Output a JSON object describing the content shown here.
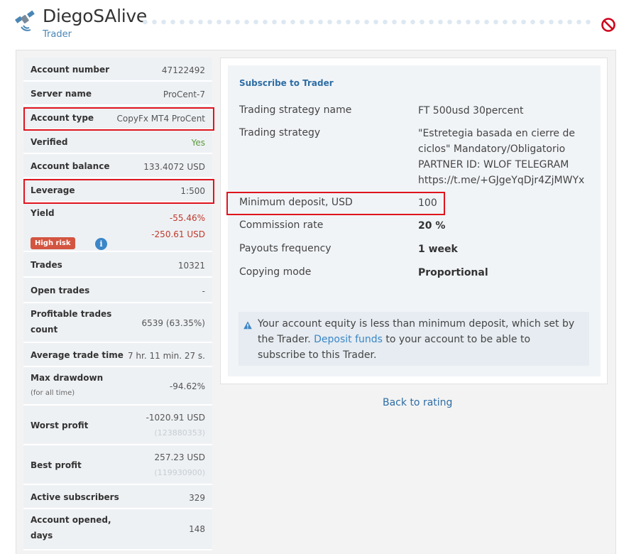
{
  "header": {
    "title": "DiegoSAlive",
    "subtitle": "Trader",
    "logo_icon": "satellite-icon",
    "status_icon": "blocked-icon"
  },
  "stats": {
    "account_number": {
      "label": "Account number",
      "value": "47122492"
    },
    "server_name": {
      "label": "Server name",
      "value": "ProCent-7"
    },
    "account_type": {
      "label": "Account type",
      "value": "CopyFx MT4 ProCent"
    },
    "verified": {
      "label": "Verified",
      "value": "Yes"
    },
    "account_balance": {
      "label": "Account balance",
      "value": "133.4072 USD"
    },
    "leverage": {
      "label": "Leverage",
      "value": "1:500"
    },
    "yield": {
      "label": "Yield",
      "value_pct": "-55.46%",
      "value_usd": "-250.61 USD",
      "badge": "High risk"
    },
    "trades": {
      "label": "Trades",
      "value": "10321"
    },
    "open_trades": {
      "label": "Open trades",
      "value": "-"
    },
    "profitable_trades": {
      "label_line1": "Profitable trades",
      "label_line2": "count",
      "value": "6539 (63.35%)"
    },
    "average_trade_time": {
      "label": "Average trade time",
      "value": "7 hr. 11 min. 27 s."
    },
    "max_drawdown": {
      "label": "Max drawdown",
      "sublabel": "(for all time)",
      "value": "-94.62%"
    },
    "worst_profit": {
      "label": "Worst profit",
      "value": "-1020.91 USD",
      "ticket": "(123880353)"
    },
    "best_profit": {
      "label": "Best profit",
      "value": "257.23 USD",
      "ticket": "(119930900)"
    },
    "active_subscribers": {
      "label": "Active subscribers",
      "value": "329"
    },
    "account_opened": {
      "label_line1": "Account opened,",
      "label_line2": "days",
      "value": "148"
    }
  },
  "subscribe": {
    "heading": "Subscribe to Trader",
    "strategy_name_label": "Trading strategy name",
    "strategy_name_value": "FT 500usd 30percent",
    "strategy_label": "Trading strategy",
    "strategy_line1": "\"Estretegia basada en cierre de",
    "strategy_line2": "ciclos\" Mandatory/Obligatorio",
    "strategy_line3": "PARTNER ID: WLOF TELEGRAM",
    "strategy_line4": "https://t.me/+GJgeYqDjr4ZjMWYx",
    "min_deposit_label": "Minimum deposit, USD",
    "min_deposit_value": "100",
    "commission_label": "Commission rate",
    "commission_value": "20 %",
    "payouts_label": "Payouts frequency",
    "payouts_value": "1 week",
    "copying_label": "Copying mode",
    "copying_value": "Proportional",
    "notice_before": "Your account equity is less than minimum deposit, which set by the Trader. ",
    "notice_link": "Deposit funds",
    "notice_after": " to your account to be able to subscribe to this Trader."
  },
  "back_link": "Back to rating"
}
